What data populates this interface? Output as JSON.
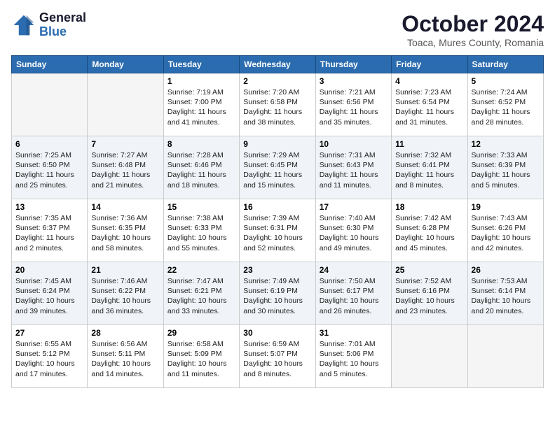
{
  "logo": {
    "general": "General",
    "blue": "Blue"
  },
  "title": "October 2024",
  "subtitle": "Toaca, Mures County, Romania",
  "days_header": [
    "Sunday",
    "Monday",
    "Tuesday",
    "Wednesday",
    "Thursday",
    "Friday",
    "Saturday"
  ],
  "weeks": [
    [
      {
        "num": "",
        "info": ""
      },
      {
        "num": "",
        "info": ""
      },
      {
        "num": "1",
        "info": "Sunrise: 7:19 AM\nSunset: 7:00 PM\nDaylight: 11 hours and 41 minutes."
      },
      {
        "num": "2",
        "info": "Sunrise: 7:20 AM\nSunset: 6:58 PM\nDaylight: 11 hours and 38 minutes."
      },
      {
        "num": "3",
        "info": "Sunrise: 7:21 AM\nSunset: 6:56 PM\nDaylight: 11 hours and 35 minutes."
      },
      {
        "num": "4",
        "info": "Sunrise: 7:23 AM\nSunset: 6:54 PM\nDaylight: 11 hours and 31 minutes."
      },
      {
        "num": "5",
        "info": "Sunrise: 7:24 AM\nSunset: 6:52 PM\nDaylight: 11 hours and 28 minutes."
      }
    ],
    [
      {
        "num": "6",
        "info": "Sunrise: 7:25 AM\nSunset: 6:50 PM\nDaylight: 11 hours and 25 minutes."
      },
      {
        "num": "7",
        "info": "Sunrise: 7:27 AM\nSunset: 6:48 PM\nDaylight: 11 hours and 21 minutes."
      },
      {
        "num": "8",
        "info": "Sunrise: 7:28 AM\nSunset: 6:46 PM\nDaylight: 11 hours and 18 minutes."
      },
      {
        "num": "9",
        "info": "Sunrise: 7:29 AM\nSunset: 6:45 PM\nDaylight: 11 hours and 15 minutes."
      },
      {
        "num": "10",
        "info": "Sunrise: 7:31 AM\nSunset: 6:43 PM\nDaylight: 11 hours and 11 minutes."
      },
      {
        "num": "11",
        "info": "Sunrise: 7:32 AM\nSunset: 6:41 PM\nDaylight: 11 hours and 8 minutes."
      },
      {
        "num": "12",
        "info": "Sunrise: 7:33 AM\nSunset: 6:39 PM\nDaylight: 11 hours and 5 minutes."
      }
    ],
    [
      {
        "num": "13",
        "info": "Sunrise: 7:35 AM\nSunset: 6:37 PM\nDaylight: 11 hours and 2 minutes."
      },
      {
        "num": "14",
        "info": "Sunrise: 7:36 AM\nSunset: 6:35 PM\nDaylight: 10 hours and 58 minutes."
      },
      {
        "num": "15",
        "info": "Sunrise: 7:38 AM\nSunset: 6:33 PM\nDaylight: 10 hours and 55 minutes."
      },
      {
        "num": "16",
        "info": "Sunrise: 7:39 AM\nSunset: 6:31 PM\nDaylight: 10 hours and 52 minutes."
      },
      {
        "num": "17",
        "info": "Sunrise: 7:40 AM\nSunset: 6:30 PM\nDaylight: 10 hours and 49 minutes."
      },
      {
        "num": "18",
        "info": "Sunrise: 7:42 AM\nSunset: 6:28 PM\nDaylight: 10 hours and 45 minutes."
      },
      {
        "num": "19",
        "info": "Sunrise: 7:43 AM\nSunset: 6:26 PM\nDaylight: 10 hours and 42 minutes."
      }
    ],
    [
      {
        "num": "20",
        "info": "Sunrise: 7:45 AM\nSunset: 6:24 PM\nDaylight: 10 hours and 39 minutes."
      },
      {
        "num": "21",
        "info": "Sunrise: 7:46 AM\nSunset: 6:22 PM\nDaylight: 10 hours and 36 minutes."
      },
      {
        "num": "22",
        "info": "Sunrise: 7:47 AM\nSunset: 6:21 PM\nDaylight: 10 hours and 33 minutes."
      },
      {
        "num": "23",
        "info": "Sunrise: 7:49 AM\nSunset: 6:19 PM\nDaylight: 10 hours and 30 minutes."
      },
      {
        "num": "24",
        "info": "Sunrise: 7:50 AM\nSunset: 6:17 PM\nDaylight: 10 hours and 26 minutes."
      },
      {
        "num": "25",
        "info": "Sunrise: 7:52 AM\nSunset: 6:16 PM\nDaylight: 10 hours and 23 minutes."
      },
      {
        "num": "26",
        "info": "Sunrise: 7:53 AM\nSunset: 6:14 PM\nDaylight: 10 hours and 20 minutes."
      }
    ],
    [
      {
        "num": "27",
        "info": "Sunrise: 6:55 AM\nSunset: 5:12 PM\nDaylight: 10 hours and 17 minutes."
      },
      {
        "num": "28",
        "info": "Sunrise: 6:56 AM\nSunset: 5:11 PM\nDaylight: 10 hours and 14 minutes."
      },
      {
        "num": "29",
        "info": "Sunrise: 6:58 AM\nSunset: 5:09 PM\nDaylight: 10 hours and 11 minutes."
      },
      {
        "num": "30",
        "info": "Sunrise: 6:59 AM\nSunset: 5:07 PM\nDaylight: 10 hours and 8 minutes."
      },
      {
        "num": "31",
        "info": "Sunrise: 7:01 AM\nSunset: 5:06 PM\nDaylight: 10 hours and 5 minutes."
      },
      {
        "num": "",
        "info": ""
      },
      {
        "num": "",
        "info": ""
      }
    ]
  ]
}
